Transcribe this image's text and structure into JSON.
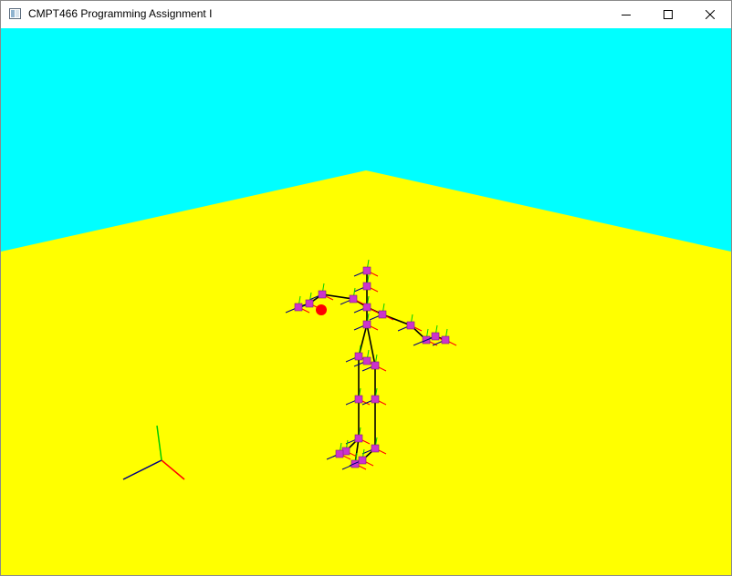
{
  "window": {
    "title": "CMPT466 Programming Assignment I",
    "app_icon": "opengl-window-icon",
    "controls": [
      {
        "name": "minimize",
        "icon": "minimize-icon"
      },
      {
        "name": "maximize",
        "icon": "maximize-icon"
      },
      {
        "name": "close",
        "icon": "close-icon"
      }
    ]
  },
  "scene": {
    "sky_color": "#00ffff",
    "floor_color": "#ffff00",
    "bone_color": "#000000",
    "joint_color": "#cc33cc",
    "end_effector_color": "#ff0000",
    "axes_colors": {
      "x": "#ff0000",
      "y": "#00cc00",
      "z": "#000080"
    }
  }
}
